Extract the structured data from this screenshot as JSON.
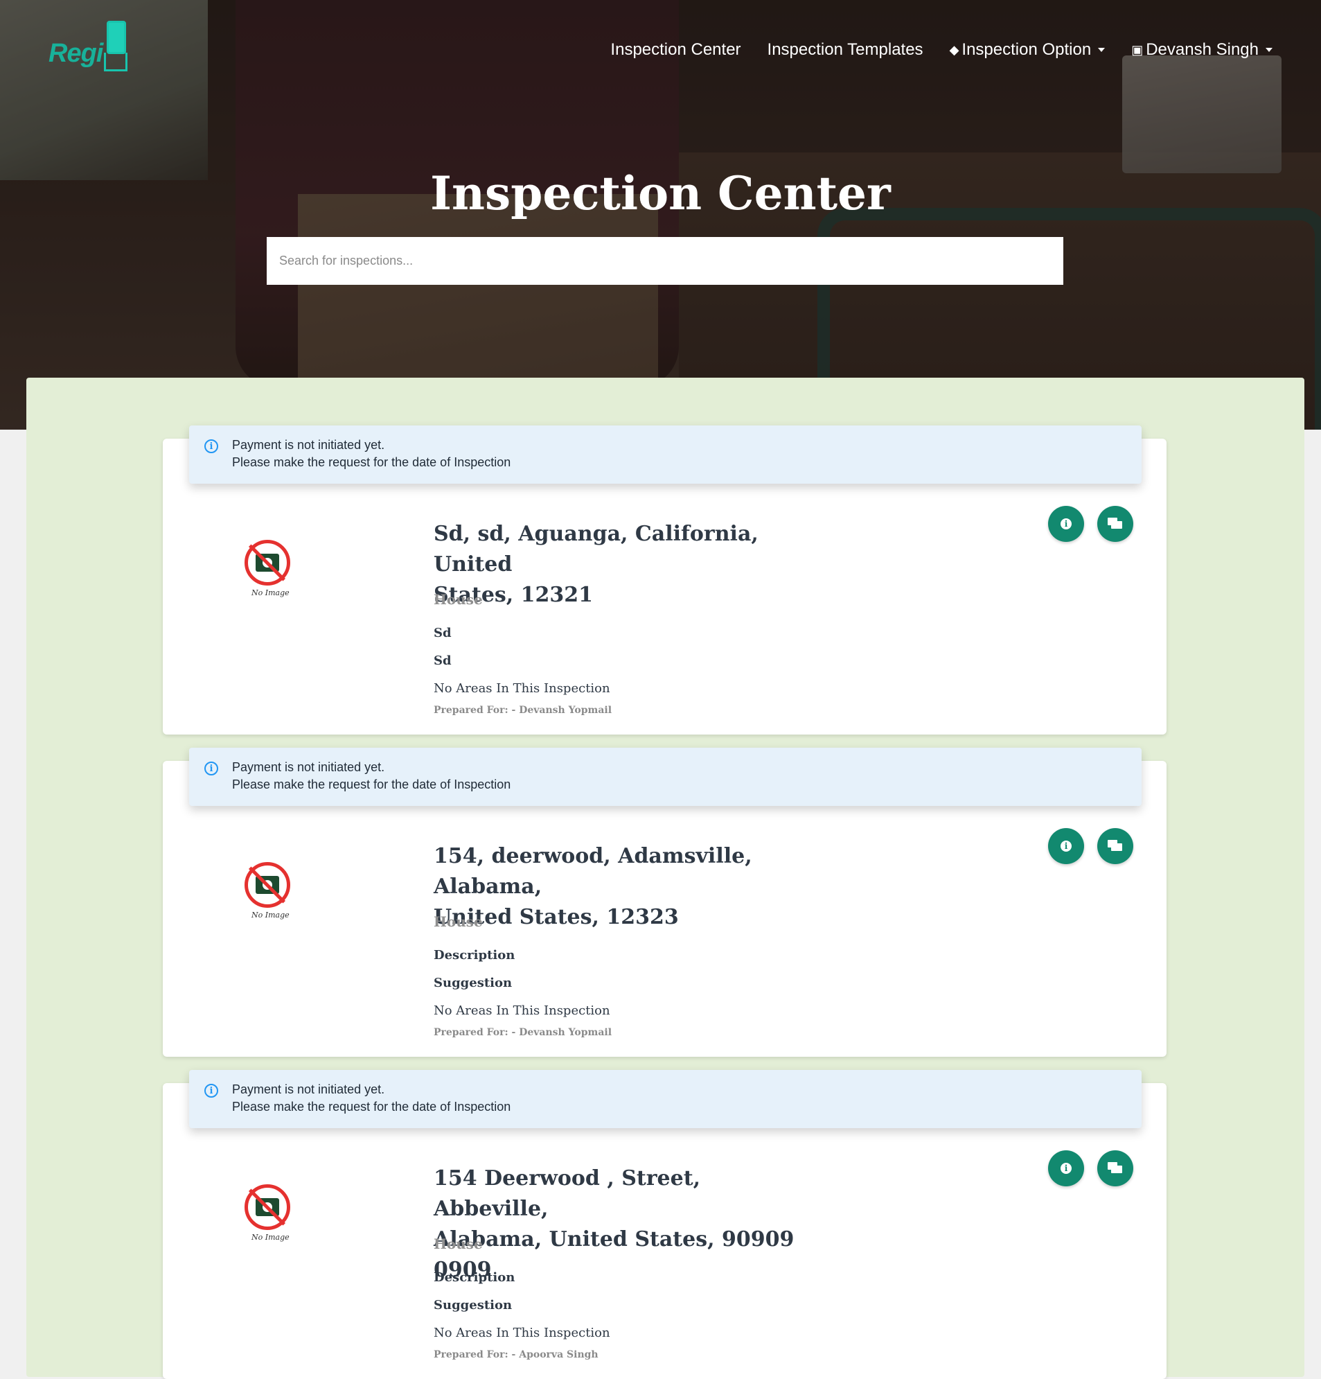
{
  "brand": {
    "logo_text": "Regi"
  },
  "nav": {
    "items": [
      {
        "label": "Inspection Center"
      },
      {
        "label": "Inspection Templates"
      },
      {
        "label": "Inspection Option"
      },
      {
        "label": "Devansh Singh"
      }
    ]
  },
  "hero": {
    "title": "Inspection Center",
    "search_placeholder": "Search for inspections..."
  },
  "inspections": [
    {
      "alert_line1": "Payment is not initiated yet.",
      "alert_line2": "Please make the request for the date of Inspection",
      "no_image_caption": "No Image",
      "address_line1": "Sd, sd, Aguanga, California, United",
      "address_line2": "States, 12321",
      "property_type": "House",
      "description": "Sd",
      "suggestion": "Sd",
      "areas": "No Areas In This Inspection",
      "prepared_for": "Prepared For: - Devansh Yopmail"
    },
    {
      "alert_line1": "Payment is not initiated yet.",
      "alert_line2": "Please make the request for the date of Inspection",
      "no_image_caption": "No Image",
      "address_line1": "154, deerwood, Adamsville, Alabama,",
      "address_line2": "United States, 12323",
      "property_type": "House",
      "description": "Description",
      "suggestion": "Suggestion",
      "areas": "No Areas In This Inspection",
      "prepared_for": "Prepared For: - Devansh Yopmail"
    },
    {
      "alert_line1": "Payment is not initiated yet.",
      "alert_line2": "Please make the request for the date of Inspection",
      "no_image_caption": "No Image",
      "address_line1": "154 Deerwood , Street, Abbeville,",
      "address_line2": "Alabama, United States, 90909 0909",
      "property_type": "House",
      "description": "Description",
      "suggestion": "Suggestion",
      "areas": "No Areas In This Inspection",
      "prepared_for": "Prepared For: - Apoorva Singh"
    }
  ],
  "colors": {
    "accent": "#12896f",
    "panel_bg": "#e3eed6",
    "alert_bg": "#e6f1fa",
    "info_blue": "#2196f3"
  },
  "icons": [
    "layers-icon",
    "user-icon",
    "info-icon",
    "chat-icon",
    "no-image-icon",
    "caret-down-icon"
  ]
}
